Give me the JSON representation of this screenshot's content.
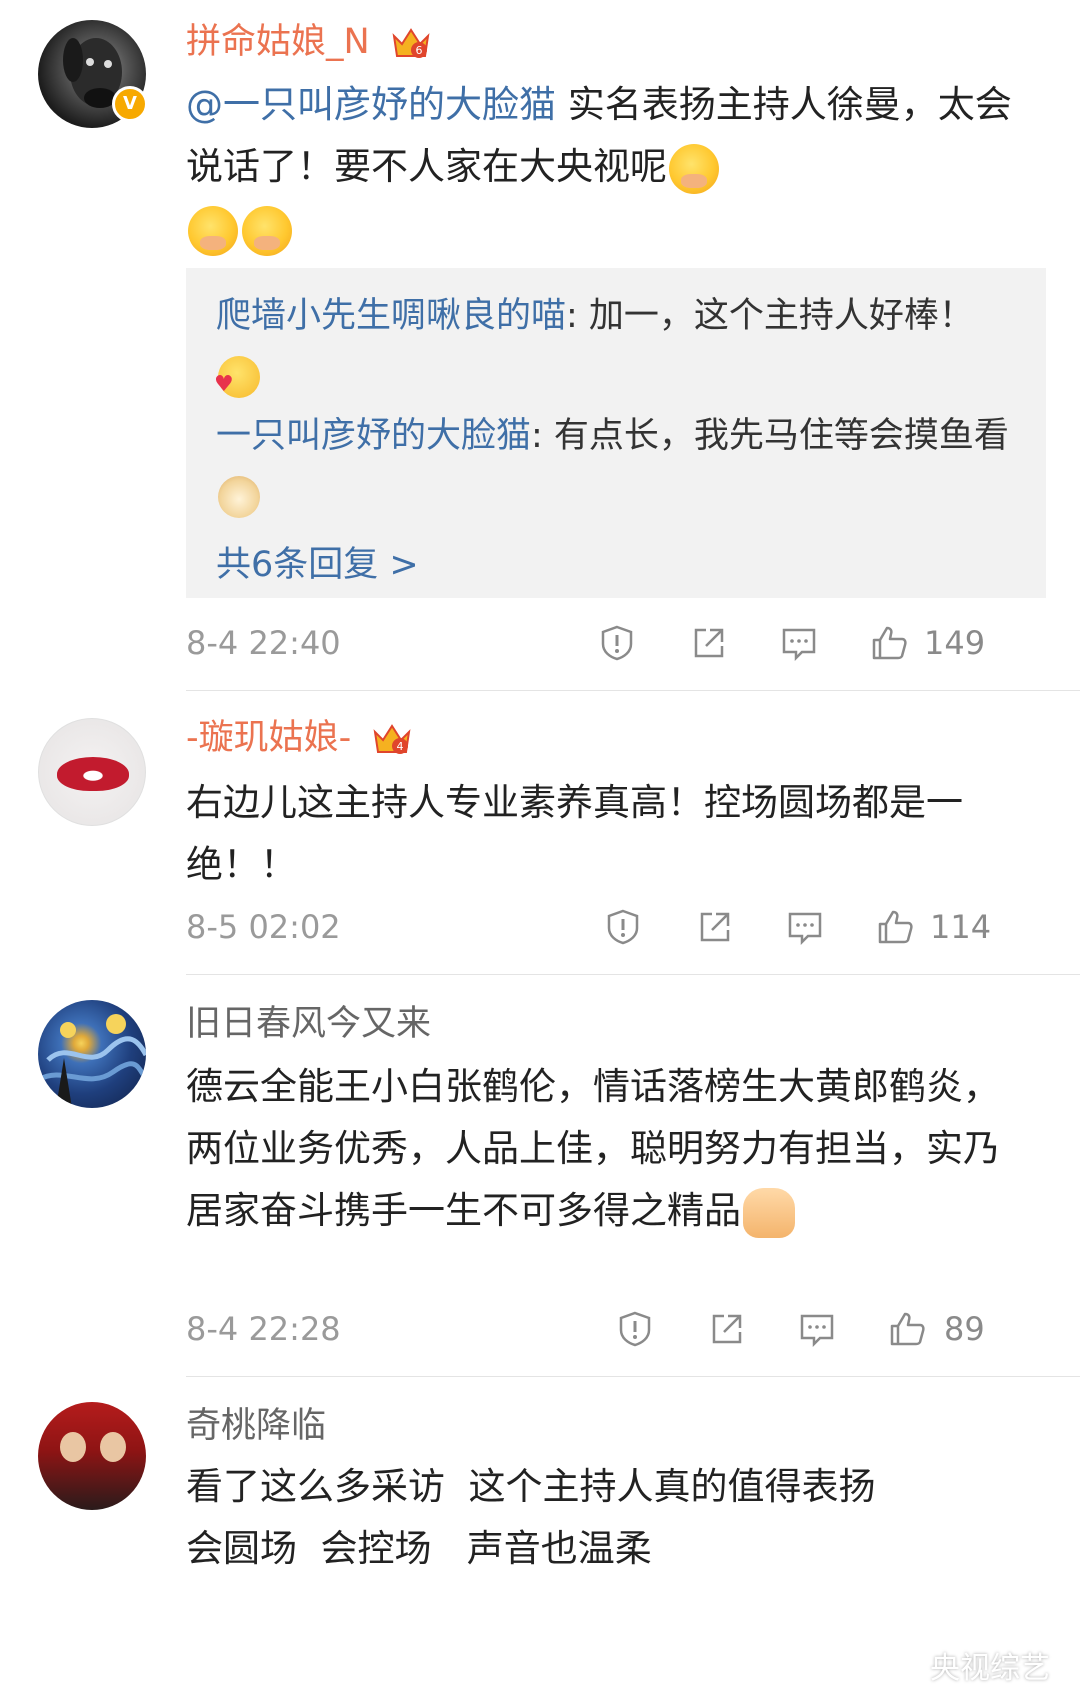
{
  "comments": [
    {
      "user": "拼命姑娘_N",
      "crown_level": "6",
      "verified": true,
      "text_mention": "@一只叫彦妤的大脸猫",
      "text_body": " 实名表扬主持人徐曼，太会说话了！要不人家在大央视呢",
      "emojis": [
        "blush-emoji",
        "blush-emoji",
        "blush-emoji"
      ],
      "replies": [
        {
          "name": "爬墙小先生啁啾良的喵",
          "text": ": 加一，这个主持人好棒！",
          "emoji": "kiss-heart-emoji"
        },
        {
          "name": "一只叫彦妤的大脸猫",
          "text": ": 有点长，我先马住等会摸鱼看",
          "emoji": "doge-emoji"
        }
      ],
      "more_replies": "共6条回复 >",
      "time": "8-4 22:40",
      "likes": "149"
    },
    {
      "user": "-璇玑姑娘-",
      "crown_level": "4",
      "text_body": "右边儿这主持人专业素养真高！控场圆场都是一绝！！",
      "time": "8-5 02:02",
      "likes": "114"
    },
    {
      "user": "旧日春风今又来",
      "text_body": "德云全能王小白张鹤伦，情话落榜生大黄郎鹤炎，两位业务优秀，人品上佳，聪明努力有担当，实乃居家奋斗携手一生不可多得之精品",
      "emoji": "thumbs-up-emoji",
      "time": "8-4 22:28",
      "likes": "89"
    },
    {
      "user": "奇桃降临",
      "text_line1": "看了这么多采访  这个主持人真的值得表扬",
      "text_line2": "会圆场  会控场   声音也温柔"
    }
  ],
  "watermark": "央视综艺",
  "colors": {
    "vip_name": "#eb7350",
    "link": "#3f6fa7",
    "meta": "#9a9a9a",
    "reply_bg": "#f2f2f2"
  }
}
